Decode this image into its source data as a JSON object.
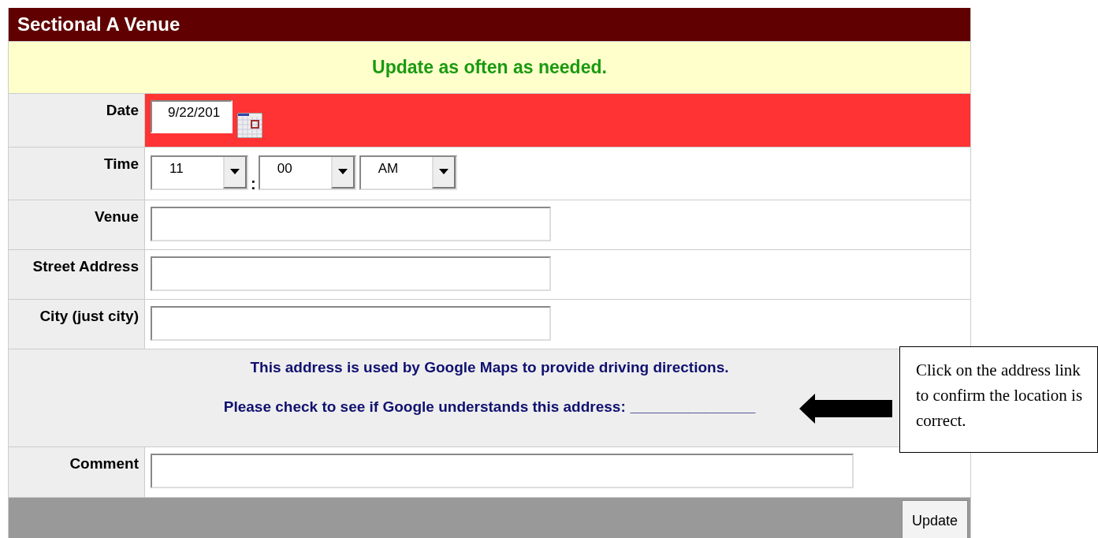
{
  "title": "Sectional A Venue",
  "banner": "Update as often as needed.",
  "fields": [
    {
      "kind": "date",
      "label": "Date",
      "value": "9/22/201",
      "highlighted": true
    },
    {
      "kind": "time",
      "label": "Time",
      "hour": "11",
      "separator": ":",
      "minute": "00",
      "period": "AM",
      "highlighted": false
    },
    {
      "kind": "text",
      "label": "Venue",
      "highlighted": false
    },
    {
      "kind": "text",
      "label": "Street Address",
      "highlighted": false
    },
    {
      "kind": "text",
      "label": "City (just city)",
      "highlighted": false
    }
  ],
  "note": {
    "line_1": "This address is used by Google Maps to provide driving directions.",
    "line_2": "Please check to see if Google understands this address:",
    "link": "_______________"
  },
  "comment": {
    "label": "Comment"
  },
  "callout": "Click on the address link to confirm the location is correct.",
  "buttons": [
    "Update"
  ]
}
